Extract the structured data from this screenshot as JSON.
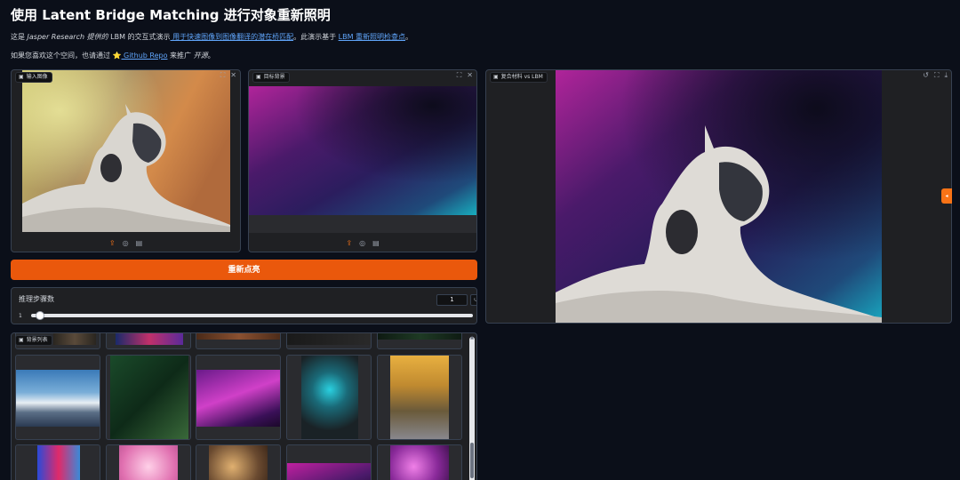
{
  "header": {
    "title": "使用 Latent Bridge Matching 进行对象重新照明",
    "line1_a": "这是 ",
    "line1_em": "Jasper Research 提供的",
    "line1_b": " LBM 的交互式演示",
    "line1_link1": " 用于快速图像到图像翻译的潜在桥匹配",
    "line1_c": "。此演示基于 ",
    "line1_link2": "LBM 重新照明检查点",
    "line1_d": "。",
    "line2_a": "如果您喜欢这个空间，也请通过 ",
    "line2_star": "⭐",
    "line2_link": " Github Repo",
    "line2_b": " 来推广 ",
    "line2_em": "开源",
    "line2_c": "。"
  },
  "input_panel": {
    "label": "输入图像",
    "icons": [
      "upload-icon",
      "webcam-icon",
      "clipboard-icon"
    ]
  },
  "target_panel": {
    "label": "目标背景",
    "icons": [
      "upload-icon",
      "webcam-icon",
      "clipboard-icon"
    ]
  },
  "result_panel": {
    "label": "复合材料 vs LBM",
    "icons": [
      "undo-icon",
      "fullscreen-icon",
      "download-icon"
    ]
  },
  "relight_button": {
    "label": "重新点亮"
  },
  "steps_slider": {
    "label": "推理步骤数",
    "value": "1",
    "min": "1",
    "max": "4",
    "fraction": 0
  },
  "gallery": {
    "label": "背景列表"
  },
  "colors": {
    "accent": "#ea580c",
    "link": "#60a5fa",
    "background": "#0b0f19",
    "panel": "#1f2023"
  }
}
